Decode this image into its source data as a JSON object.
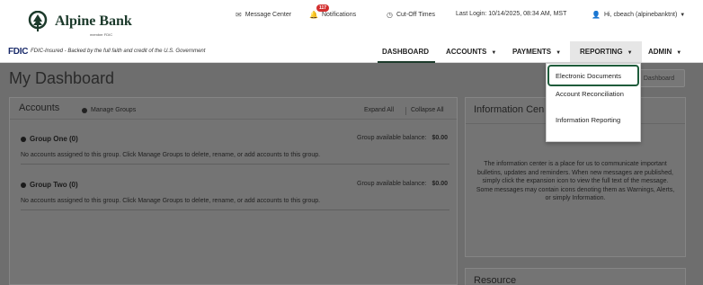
{
  "brand": {
    "name": "Alpine Bank",
    "tagline": "member FDIC"
  },
  "topnav": {
    "message_center": "Message Center",
    "notifications": "Notifications",
    "notifications_count": "117",
    "cutoff_times": "Cut-Off Times",
    "last_login": "Last Login: 10/14/2025, 08:34 AM, MST",
    "user": "Hi, cbeach (alpinebanktnt)"
  },
  "fdic": {
    "logo": "FDIC",
    "text": "FDIC-Insured - Backed by the full faith and credit of the U.S. Government"
  },
  "mainnav": {
    "dashboard": "DASHBOARD",
    "accounts": "ACCOUNTS",
    "payments": "PAYMENTS",
    "reporting": "REPORTING",
    "admin": "ADMIN"
  },
  "page": {
    "title": "My Dashboard",
    "customize_button": "Dashboard"
  },
  "accounts_panel": {
    "title": "Accounts",
    "manage_groups": "Manage Groups",
    "expand_all": "Expand All",
    "collapse_all": "Collapse All",
    "groups": [
      {
        "name": "Group One (0)",
        "balance_label": "Group available balance:",
        "balance_value": "$0.00",
        "message": "No accounts assigned to this group. Click Manage Groups to delete, rename, or add accounts to this group."
      },
      {
        "name": "Group Two (0)",
        "balance_label": "Group available balance:",
        "balance_value": "$0.00",
        "message": "No accounts assigned to this group. Click Manage Groups to delete, rename, or add accounts to this group."
      }
    ]
  },
  "info_panel": {
    "title": "Information Cen",
    "body": "The information center is a place for us to communicate important bulletins, updates and reminders. When new messages are published, simply click the expansion icon to view the full text of the message. Some messages may contain icons denoting them as Warnings, Alerts, or simply Information."
  },
  "resource_panel": {
    "title": "Resource"
  },
  "reporting_menu": {
    "items": [
      "Electronic Documents",
      "Account Reconciliation",
      "Information Reporting"
    ]
  },
  "colors": {
    "brand_green": "#1f5c3b",
    "badge_red": "#d32f2f",
    "navy": "#1a2b6a"
  }
}
